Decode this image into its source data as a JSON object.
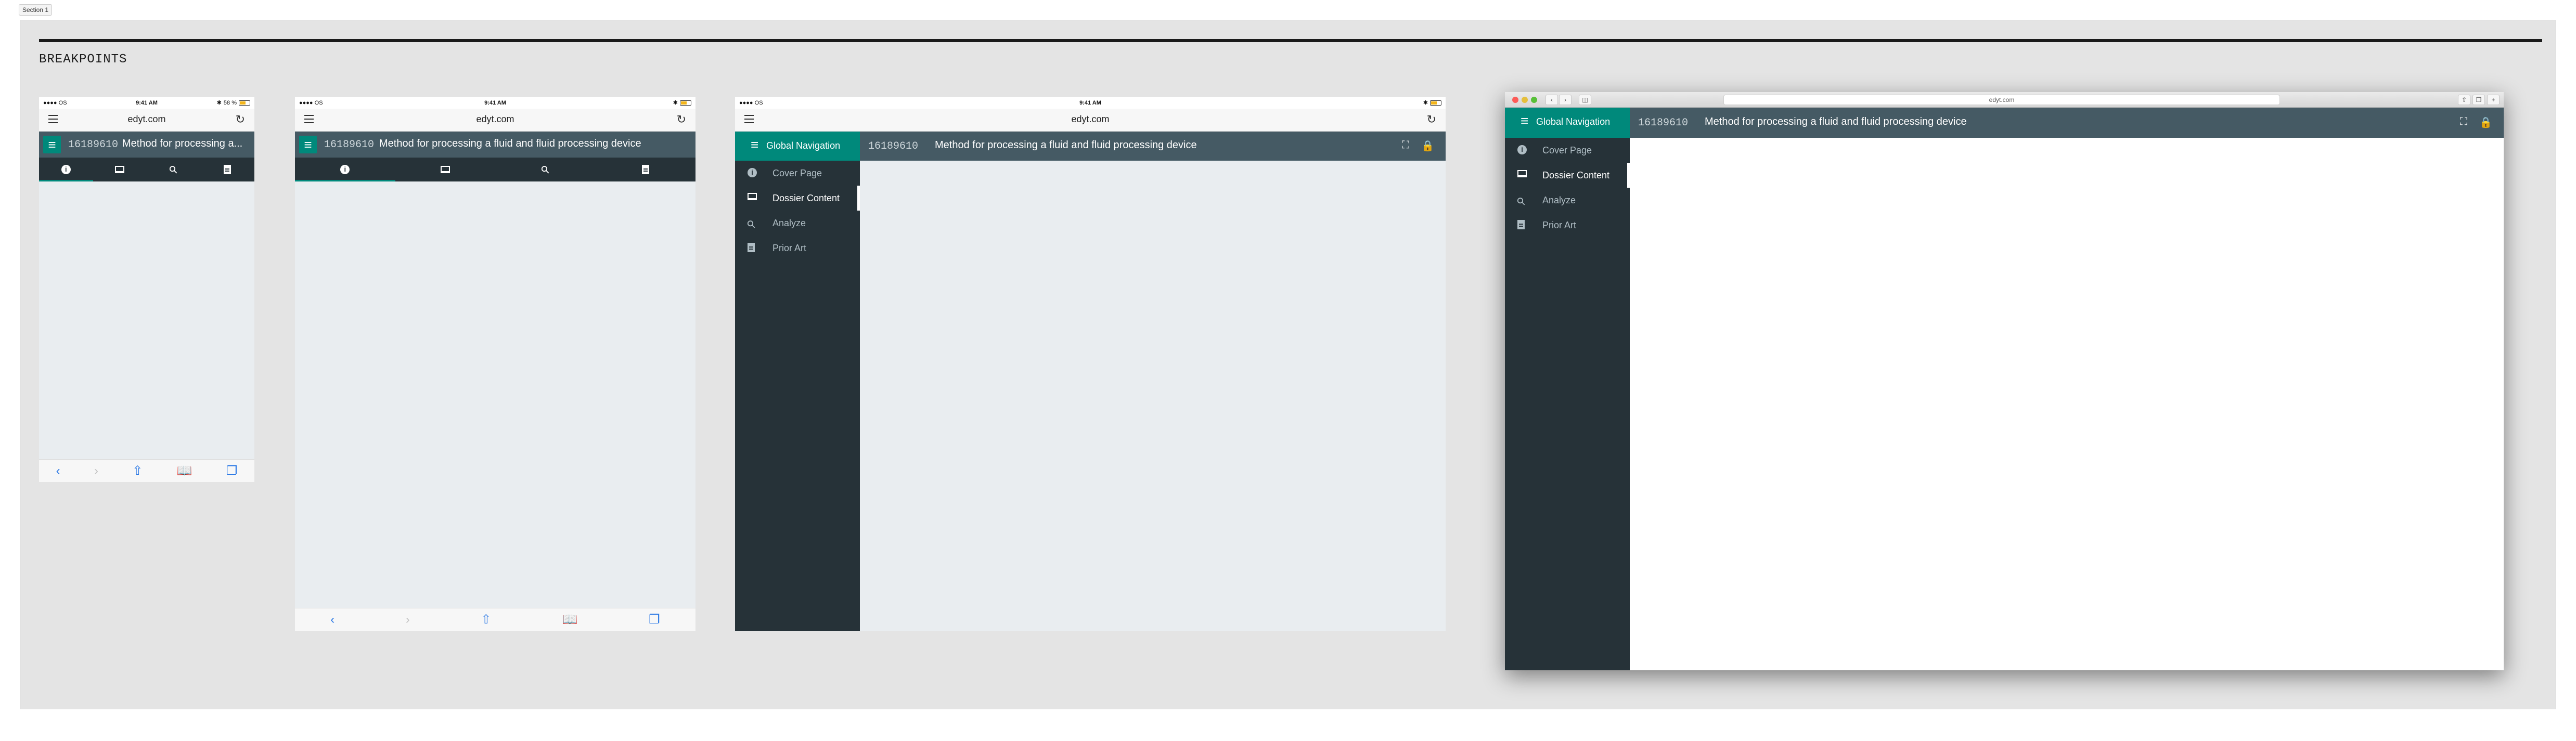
{
  "section_label": "Section 1",
  "page_heading": "BREAKPOINTS",
  "url": "edyt.com",
  "patent_number": "16189610",
  "patent_title": "Method for processing a fluid and fluid processing device",
  "patent_title_truncated": "Method for processing a...",
  "status_bar": {
    "carrier": "OS",
    "time": "9:41 AM",
    "battery": "58 %",
    "bluetooth": "✱"
  },
  "global_nav_label": "Global Navigation",
  "nav_items": [
    {
      "label": "Cover Page",
      "icon": "info-icon",
      "active": false
    },
    {
      "label": "Dossier Content",
      "icon": "dossier-icon",
      "active": true
    },
    {
      "label": "Analyze",
      "icon": "search-icon",
      "active": false
    },
    {
      "label": "Prior Art",
      "icon": "document-icon",
      "active": false
    }
  ],
  "tab_icons": [
    "info-icon",
    "dossier-icon",
    "search-icon",
    "document-icon"
  ],
  "active_tab": 0,
  "safari_toolbar_icons": [
    "back-icon",
    "forward-icon",
    "share-icon",
    "bookmarks-icon",
    "tabs-icon"
  ],
  "colors": {
    "accent": "#00897b",
    "app_bar": "#455a64",
    "nav_dark": "#263238",
    "content_bg": "#e9edf0",
    "ios_blue": "#2f7be5"
  }
}
